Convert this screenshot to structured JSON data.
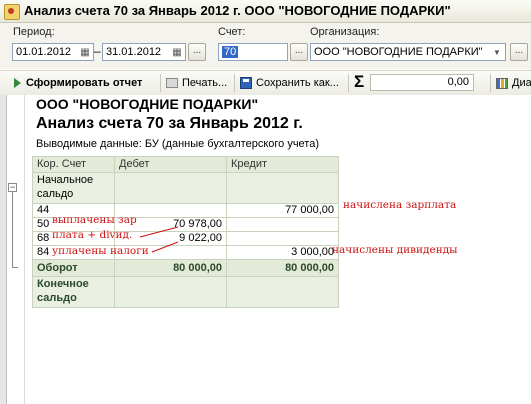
{
  "window": {
    "title": "Анализ счета 70 за Январь 2012 г. ООО \"НОВОГОДНИЕ ПОДАРКИ\""
  },
  "params": {
    "period_label": "Период:",
    "date_from": "01.01.2012",
    "date_to": "31.01.2012",
    "period_dash": "–",
    "period_more": "...",
    "account_label": "Счет:",
    "account_value": "70",
    "account_more": "...",
    "org_label": "Организация:",
    "org_value": "ООО \"НОВОГОДНИЕ ПОДАРКИ\"",
    "org_dropdown": "▼",
    "org_more": "..."
  },
  "toolbar": {
    "generate_label": "Сформировать отчет",
    "print_label": "Печать...",
    "save_label": "Сохранить как...",
    "sigma": "Σ",
    "sum_value": "0,00",
    "diagram_label": "Диа"
  },
  "report": {
    "org_name": "ООО \"НОВОГОДНИЕ ПОДАРКИ\"",
    "title": "Анализ счета 70 за Январь 2012 г.",
    "subtitle": "Выводимые данные:  БУ (данные бухгалтерского учета)",
    "columns": [
      "Кор. Счет",
      "Дебет",
      "Кредит"
    ],
    "opening_label": "Начальное сальдо",
    "rows": [
      {
        "account": "44",
        "debit": "",
        "credit": "77 000,00"
      },
      {
        "account": "50",
        "debit": "70 978,00",
        "credit": ""
      },
      {
        "account": "68",
        "debit": "9 022,00",
        "credit": ""
      },
      {
        "account": "84",
        "debit": "",
        "credit": "3 000,00"
      }
    ],
    "turnover": {
      "label": "Оборот",
      "debit": "80 000,00",
      "credit": "80 000,00"
    },
    "closing_label": "Конечное сальдо",
    "collapse_symbol": "−"
  },
  "annotations": {
    "salary_accrued": "начислена зарплата",
    "paid_line1": "выплачены зар",
    "paid_line2": "плата + divид.",
    "taxes_paid": "уплачены налоги",
    "dividends_accrued": "начислены дивиденды"
  },
  "colors": {
    "accent": "#3569c6",
    "table_header": "#e3ead7",
    "annotation": "#cc1010"
  }
}
